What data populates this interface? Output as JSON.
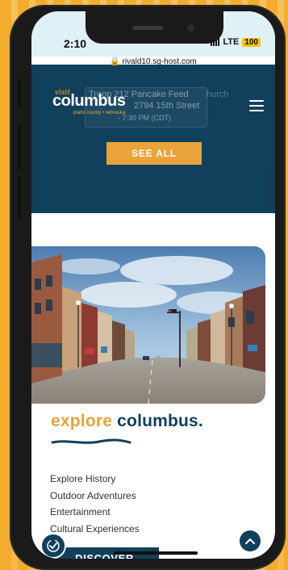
{
  "status": {
    "time": "2:10",
    "network": "LTE",
    "battery": "100"
  },
  "browser": {
    "url": "rivald10.sg-host.com"
  },
  "header": {
    "logo_visit": "visit",
    "logo_main": "columbus",
    "logo_sub": "platte county • nebraska",
    "event": {
      "title": "Troop 212 Pancake Feed",
      "title_extra": "hurch",
      "address": "2794 15th Street",
      "time": "- 7:30 PM (CDT)"
    },
    "see_all_label": "SEE ALL"
  },
  "explore": {
    "title_word1": "explore",
    "title_word2": "columbus.",
    "links": [
      "Explore History",
      "Outdoor Adventures",
      "Entertainment",
      "Cultural Experiences"
    ]
  },
  "footer": {
    "discover_label": "DISCOVER"
  },
  "colors": {
    "navy": "#11405c",
    "orange": "#e9a33a",
    "background": "#f2a92a"
  }
}
